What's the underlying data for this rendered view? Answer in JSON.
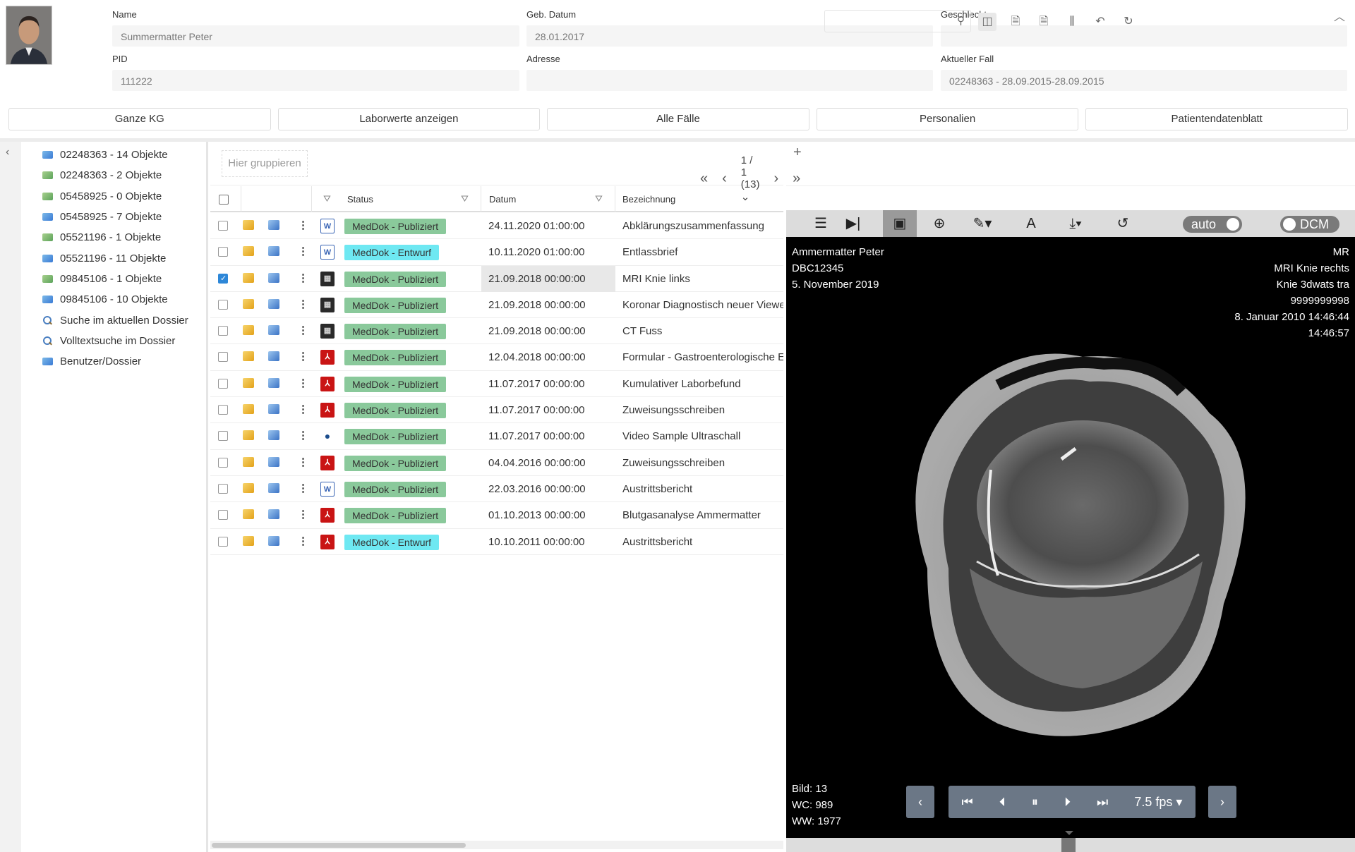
{
  "patient": {
    "name_label": "Name",
    "name_value": "Summermatter Peter",
    "dob_label": "Geb. Datum",
    "dob_value": "28.01.2017",
    "sex_label": "Geschlecht",
    "sex_value": "",
    "pid_label": "PID",
    "pid_value": "111222",
    "address_label": "Adresse",
    "address_value": "",
    "case_label": "Aktueller Fall",
    "case_value": "02248363 - 28.09.2015-28.09.2015"
  },
  "actions": [
    "Ganze KG",
    "Laborwerte anzeigen",
    "Alle Fälle",
    "Personalien",
    "Patientendatenblatt"
  ],
  "tree": [
    {
      "label": "02248363 - 14 Objekte",
      "icon": "folder-blue"
    },
    {
      "label": "02248363 - 2 Objekte",
      "icon": "folder-green"
    },
    {
      "label": "05458925 - 0 Objekte",
      "icon": "folder-green"
    },
    {
      "label": "05458925 - 7 Objekte",
      "icon": "folder-blue"
    },
    {
      "label": "05521196 - 1 Objekte",
      "icon": "folder-green"
    },
    {
      "label": "05521196 - 11 Objekte",
      "icon": "folder-blue"
    },
    {
      "label": "09845106 - 1 Objekte",
      "icon": "folder-green"
    },
    {
      "label": "09845106 - 10 Objekte",
      "icon": "folder-blue"
    },
    {
      "label": "Suche im aktuellen Dossier",
      "icon": "search"
    },
    {
      "label": "Volltextsuche im Dossier",
      "icon": "search"
    },
    {
      "label": "Benutzer/Dossier",
      "icon": "folder-blue"
    }
  ],
  "grid": {
    "group_placeholder": "Hier gruppieren",
    "pager": "1 / 1 (13)",
    "col_status": "Status",
    "col_date": "Datum",
    "col_name": "Bezeichnung",
    "rows": [
      {
        "type": "word",
        "status": "MedDok - Publiziert",
        "kind": "pub",
        "date": "24.11.2020 01:00:00",
        "name": "Abklärungszusammenfassung",
        "checked": false
      },
      {
        "type": "word",
        "status": "MedDok - Entwurf",
        "kind": "ent",
        "date": "10.11.2020 01:00:00",
        "name": "Entlassbrief",
        "checked": false
      },
      {
        "type": "mri",
        "status": "MedDok - Publiziert",
        "kind": "pub",
        "date": "21.09.2018 00:00:00",
        "name": "MRI Knie links",
        "checked": true
      },
      {
        "type": "mri",
        "status": "MedDok - Publiziert",
        "kind": "pub",
        "date": "21.09.2018 00:00:00",
        "name": "Koronar Diagnostisch neuer Viewer",
        "checked": false
      },
      {
        "type": "mri",
        "status": "MedDok - Publiziert",
        "kind": "pub",
        "date": "21.09.2018 00:00:00",
        "name": "CT Fuss",
        "checked": false
      },
      {
        "type": "pdf",
        "status": "MedDok - Publiziert",
        "kind": "pub",
        "date": "12.04.2018 00:00:00",
        "name": "Formular - Gastroenterologische Endoskopie",
        "checked": false
      },
      {
        "type": "pdf",
        "status": "MedDok - Publiziert",
        "kind": "pub",
        "date": "11.07.2017 00:00:00",
        "name": "Kumulativer Laborbefund",
        "checked": false
      },
      {
        "type": "pdf",
        "status": "MedDok - Publiziert",
        "kind": "pub",
        "date": "11.07.2017 00:00:00",
        "name": "Zuweisungsschreiben",
        "checked": false
      },
      {
        "type": "vid",
        "status": "MedDok - Publiziert",
        "kind": "pub",
        "date": "11.07.2017 00:00:00",
        "name": "Video Sample Ultraschall",
        "checked": false
      },
      {
        "type": "pdf",
        "status": "MedDok - Publiziert",
        "kind": "pub",
        "date": "04.04.2016 00:00:00",
        "name": "Zuweisungsschreiben",
        "checked": false
      },
      {
        "type": "word",
        "status": "MedDok - Publiziert",
        "kind": "pub",
        "date": "22.03.2016 00:00:00",
        "name": "Austrittsbericht",
        "checked": false
      },
      {
        "type": "pdf",
        "status": "MedDok - Publiziert",
        "kind": "pub",
        "date": "01.10.2013 00:00:00",
        "name": "Blutgasanalyse Ammermatter",
        "checked": false
      },
      {
        "type": "pdf",
        "status": "MedDok - Entwurf",
        "kind": "ent",
        "date": "10.10.2011 00:00:00",
        "name": "Austrittsbericht",
        "checked": false
      }
    ]
  },
  "viewer": {
    "auto_label": "auto",
    "dcm_label": "DCM",
    "tl": [
      "Ammermatter Peter",
      "DBC12345",
      "5. November 2019"
    ],
    "tr": [
      "MR",
      "MRI Knie rechts",
      "Knie 3dwats tra",
      "9999999998",
      "8. Januar 2010 14:46:44",
      "14:46:57"
    ],
    "bl": [
      "Bild: 13",
      "WC: 989",
      "WW: 1977"
    ],
    "fps": "7.5 fps"
  }
}
